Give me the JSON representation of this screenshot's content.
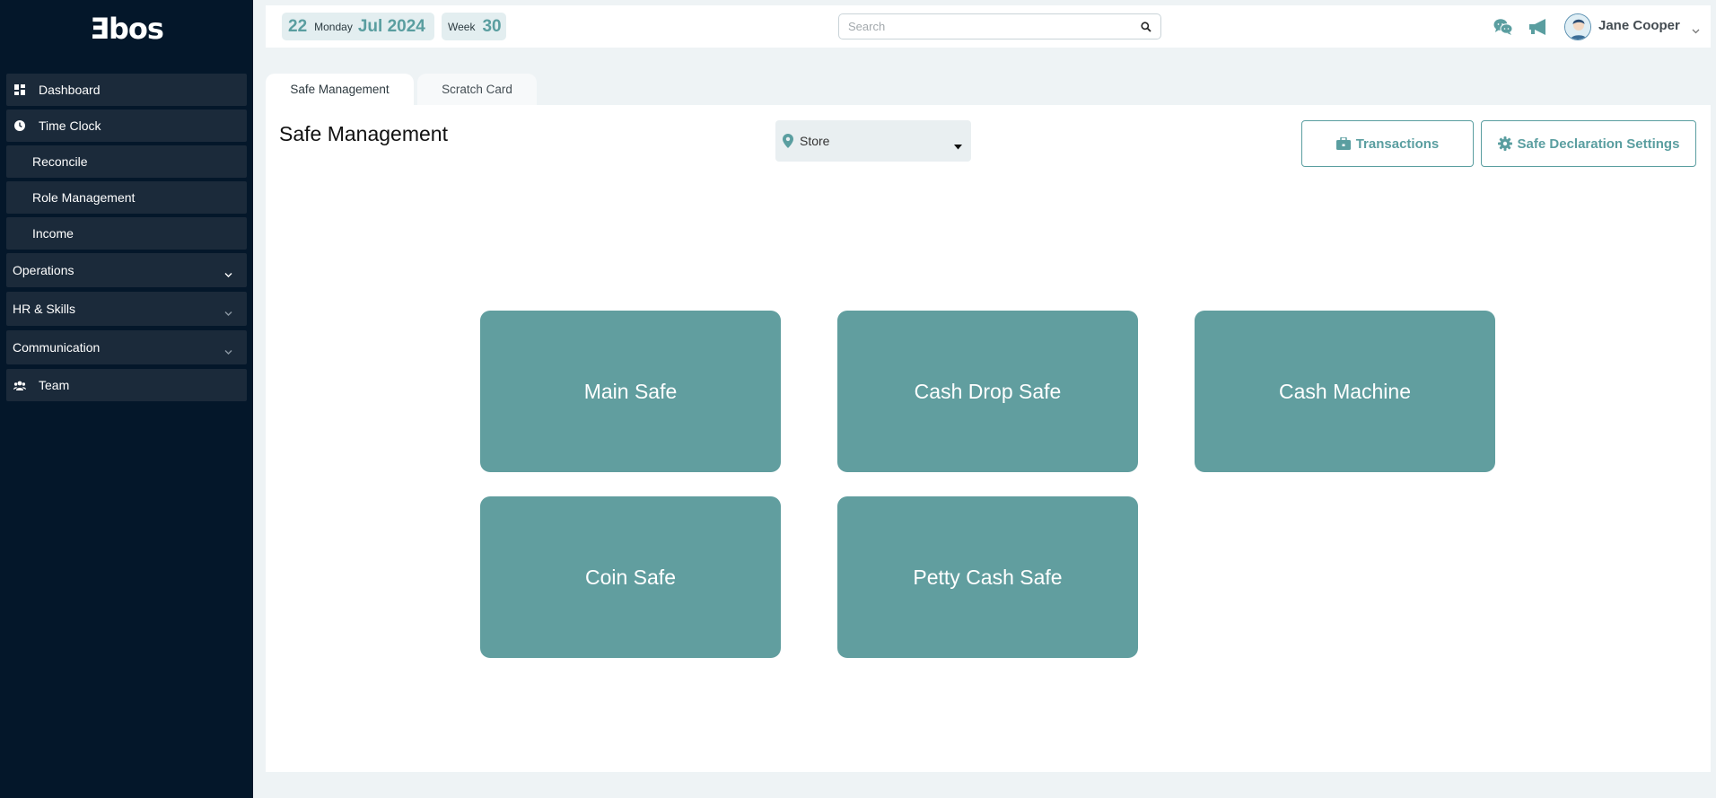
{
  "brand": {
    "logo_text": "Ǝbos"
  },
  "sidebar": {
    "items": [
      {
        "label": "Dashboard",
        "icon": "dashboard-icon"
      },
      {
        "label": "Time Clock",
        "icon": "clock-icon"
      },
      {
        "label": "Reconcile"
      },
      {
        "label": "Role Management"
      },
      {
        "label": "Income"
      },
      {
        "label": "Operations",
        "icon": "chevron-down-icon"
      },
      {
        "label": "HR & Skills",
        "icon": "chevron-down-icon"
      },
      {
        "label": "Communication",
        "icon": "chevron-down-icon"
      },
      {
        "label": "Team",
        "icon": "team-icon"
      }
    ]
  },
  "topbar": {
    "date_day": "22",
    "date_weekday": "Monday",
    "date_month_year": "Jul 2024",
    "week_label": "Week",
    "week_number": "30",
    "search_placeholder": "Search",
    "user_name": "Jane Cooper"
  },
  "tabs": [
    {
      "label": "Safe Management",
      "active": true
    },
    {
      "label": "Scratch Card",
      "active": false
    }
  ],
  "main": {
    "page_title": "Safe Management",
    "store_select": {
      "selected": "Store"
    },
    "buttons": {
      "transactions": "Transactions",
      "safe_declaration_settings": "Safe Declaration Settings"
    },
    "safes": [
      "Main Safe",
      "Cash Drop Safe",
      "Cash Machine",
      "Coin Safe",
      "Petty Cash Safe"
    ]
  },
  "colors": {
    "sidebar_bg": "#04172a",
    "nav_item_bg": "#1b2a3a",
    "accent_teal": "#5a9ea0",
    "safe_card_bg": "#619e9f",
    "page_bg": "#eef3f5"
  }
}
